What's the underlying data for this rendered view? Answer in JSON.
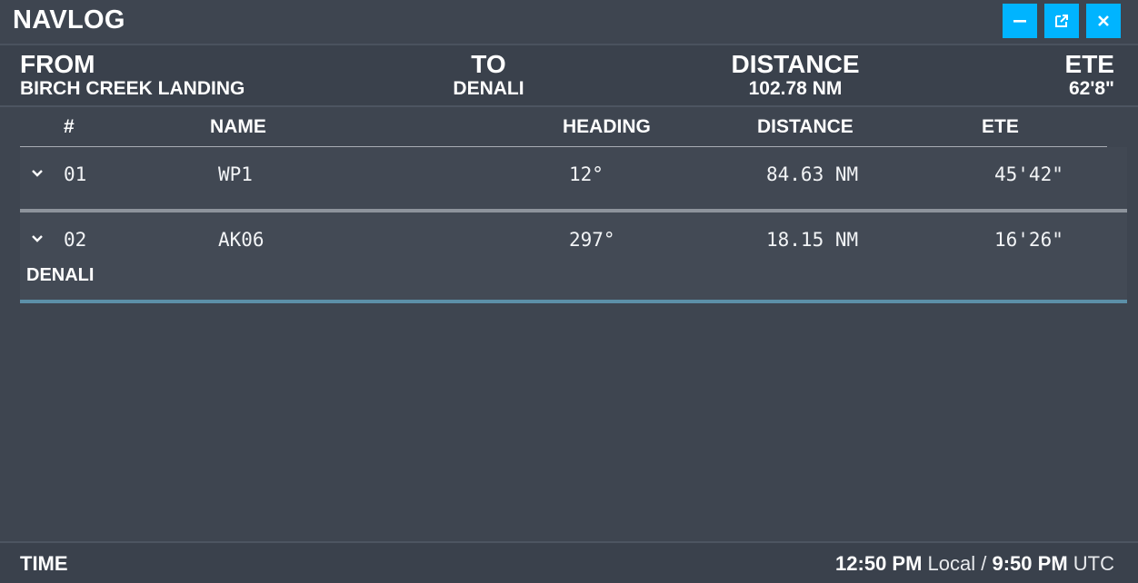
{
  "window": {
    "title": "NAVLOG",
    "buttons": {
      "minimize_icon": "minimize-icon",
      "popout_icon": "popout-icon",
      "close_icon": "close-icon",
      "accent_color": "#00b4ff"
    }
  },
  "summary": {
    "from_label": "FROM",
    "from_value": "BIRCH CREEK LANDING",
    "to_label": "TO",
    "to_value": "DENALI",
    "distance_label": "DISTANCE",
    "distance_value": "102.78 NM",
    "ete_label": "ETE",
    "ete_value": "62'8\""
  },
  "table": {
    "headers": {
      "index": "#",
      "name": "NAME",
      "heading": "HEADING",
      "distance": "DISTANCE",
      "ete": "ETE"
    },
    "rows": [
      {
        "index": "01",
        "name": "WP1",
        "heading": "12°",
        "distance": "84.63 NM",
        "ete": "45'42\""
      },
      {
        "index": "02",
        "name": "AK06",
        "heading": "297°",
        "distance": "18.15 NM",
        "ete": "16'26\"",
        "destination": "DENALI"
      }
    ]
  },
  "footer": {
    "label": "TIME",
    "local_time": "12:50 PM",
    "local_suffix": "Local /",
    "utc_time": "9:50 PM",
    "utc_suffix": "UTC"
  }
}
